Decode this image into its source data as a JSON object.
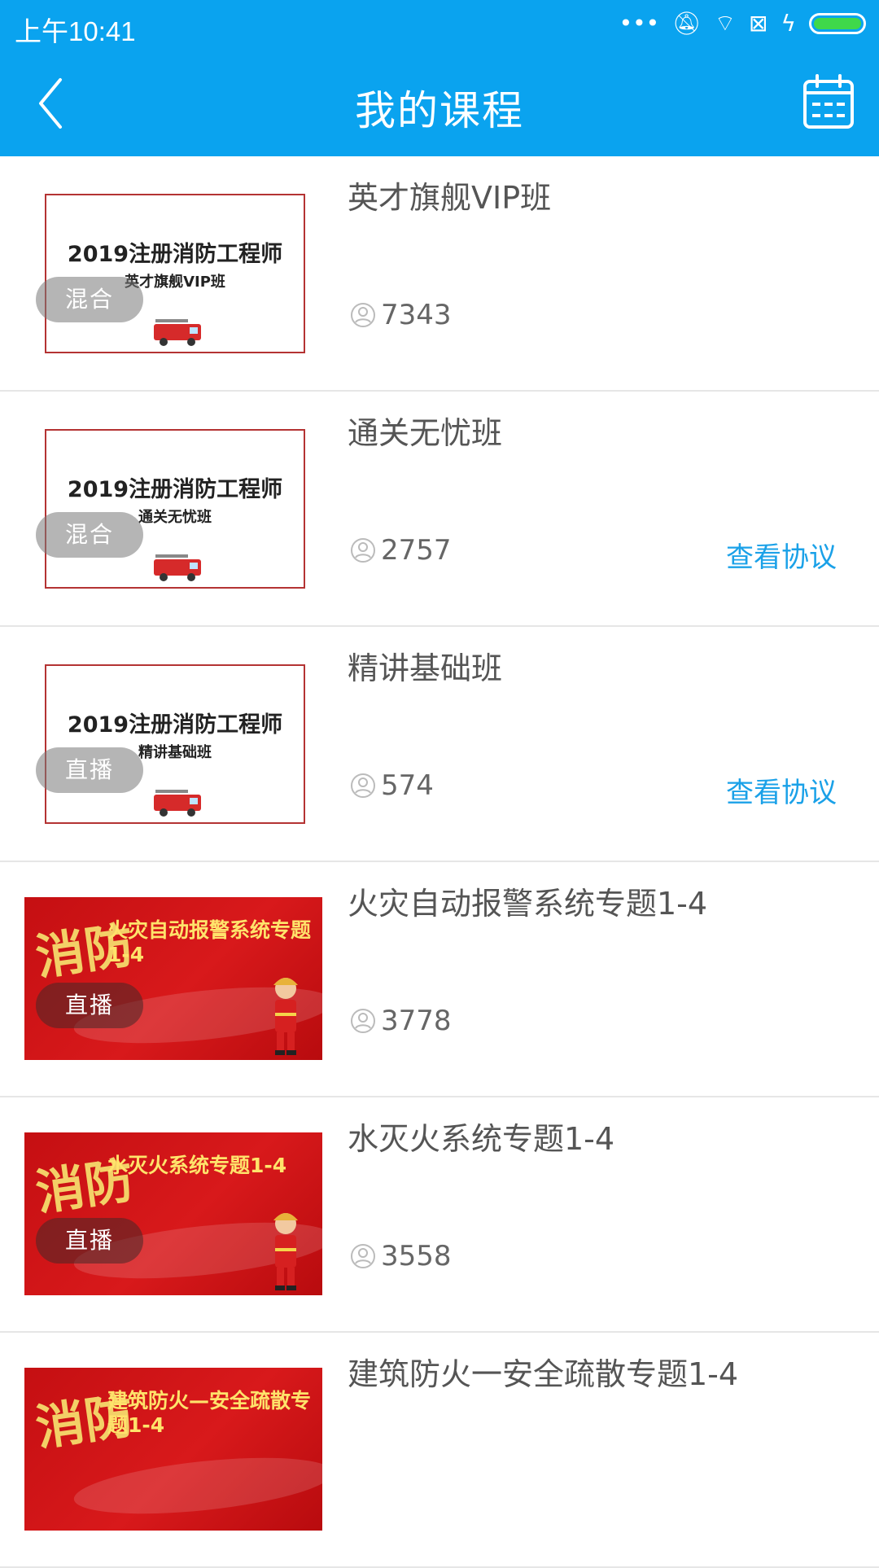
{
  "status": {
    "time": "上午10:41",
    "icons": [
      "more-icon",
      "mute-icon",
      "wifi-icon",
      "sim-icon",
      "charging-icon",
      "battery-icon"
    ]
  },
  "header": {
    "title": "我的课程",
    "back_icon": "back-icon",
    "calendar_icon": "calendar-icon"
  },
  "courses": [
    {
      "title": "英才旗舰VIP班",
      "count": "7343",
      "badge": "混合",
      "thumb_head": "2019注册消防工程师",
      "thumb_sub": "英才旗舰VIP班",
      "agreement": ""
    },
    {
      "title": "通关无忧班",
      "count": "2757",
      "badge": "混合",
      "thumb_head": "2019注册消防工程师",
      "thumb_sub": "通关无忧班",
      "agreement": "查看协议"
    },
    {
      "title": "精讲基础班",
      "count": "574",
      "badge": "直播",
      "thumb_head": "2019注册消防工程师",
      "thumb_sub": "精讲基础班",
      "agreement": "查看协议"
    },
    {
      "title": "火灾自动报警系统专题1-4",
      "count": "3778",
      "badge": "直播",
      "thumb_head": "火灾自动报警系统专题1-4",
      "calligraphy": "消防",
      "agreement": ""
    },
    {
      "title": "水灭火系统专题1-4",
      "count": "3558",
      "badge": "直播",
      "thumb_head": "水灭火系统专题1-4",
      "calligraphy": "消防",
      "agreement": ""
    },
    {
      "title": "建筑防火一安全疏散专题1-4",
      "count": "",
      "badge": "",
      "thumb_head": "建筑防火—安全疏散专题1-4",
      "calligraphy": "消防",
      "agreement": ""
    }
  ],
  "colors": {
    "accent": "#0aa3ef",
    "link": "#1aa1e8",
    "text": "#555555"
  }
}
